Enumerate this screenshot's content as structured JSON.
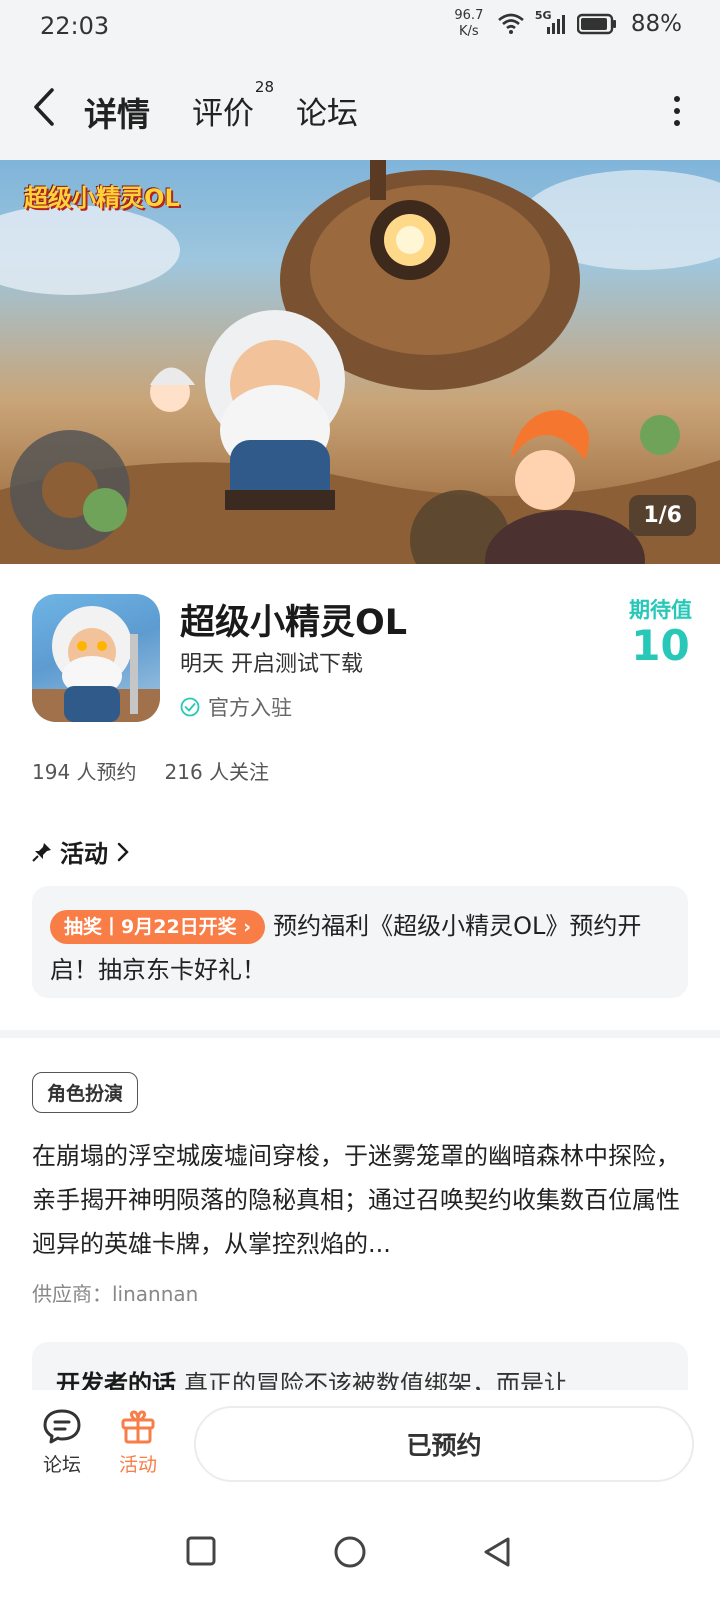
{
  "status_bar": {
    "time": "22:03",
    "net_speed_value": "96.7",
    "net_speed_unit": "K/s",
    "signal_label": "5G",
    "battery_percent": "88%"
  },
  "header": {
    "tabs": [
      {
        "label": "详情"
      },
      {
        "label": "评价",
        "count": "28"
      },
      {
        "label": "论坛"
      }
    ]
  },
  "banner": {
    "logo_text": "超级小精灵OL",
    "counter": "1/6"
  },
  "game": {
    "title": "超级小精灵OL",
    "subtitle": "明天 开启测试下载",
    "official_label": "官方入驻",
    "expect_label": "期待值",
    "expect_value": "10",
    "reservations": "194 人预约",
    "followers": "216 人关注"
  },
  "activity": {
    "title": "活动",
    "badge": "抽奖丨9月22日开奖",
    "text": "预约福利《超级小精灵OL》预约开启！抽京东卡好礼！"
  },
  "detail": {
    "genre_tag": "角色扮演",
    "description": "在崩塌的浮空城废墟间穿梭，于迷雾笼罩的幽暗森林中探险，亲手揭开神明陨落的隐秘真相；通过召唤契约收集数百位属性迥异的英雄卡牌，从掌控烈焰的...",
    "provider": "供应商：linannan",
    "dev_words_label": "开发者的话",
    "dev_words_text": "真正的冒险不该被数值绑架，而是让"
  },
  "bottom_bar": {
    "forum_label": "论坛",
    "activity_label": "活动",
    "reserved_label": "已预约"
  },
  "colors": {
    "accent_teal": "#27d3c3",
    "accent_orange": "#f97d47"
  }
}
